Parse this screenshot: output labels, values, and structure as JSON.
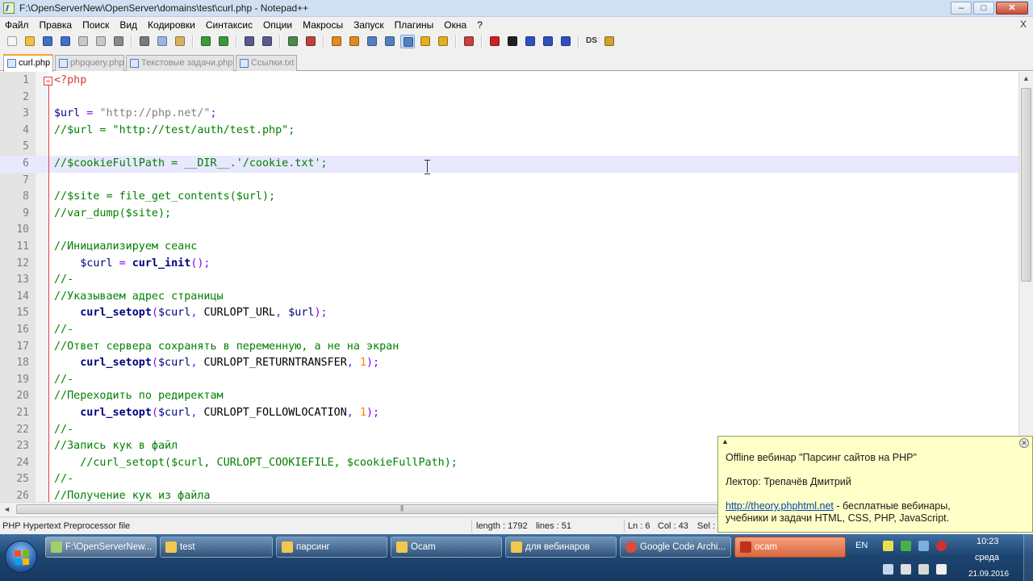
{
  "window": {
    "title": "F:\\OpenServerNew\\OpenServer\\domains\\test\\curl.php - Notepad++",
    "minimize_glyph": "–",
    "maximize_glyph": "□",
    "close_glyph": "✕"
  },
  "menu": {
    "items": [
      "Файл",
      "Правка",
      "Поиск",
      "Вид",
      "Кодировки",
      "Синтаксис",
      "Опции",
      "Макросы",
      "Запуск",
      "Плагины",
      "Окна",
      "?"
    ],
    "close_glyph": "X"
  },
  "toolbar": {
    "buttons": [
      {
        "icon": "new-file-icon",
        "color": "#f7f7f7"
      },
      {
        "icon": "open-file-icon",
        "color": "#f0c040"
      },
      {
        "icon": "save-icon",
        "color": "#3f6fc8"
      },
      {
        "icon": "save-all-icon",
        "color": "#3f6fc8"
      },
      {
        "icon": "close-file-icon",
        "color": "#c8c8c8"
      },
      {
        "icon": "close-all-icon",
        "color": "#c8c8c8"
      },
      {
        "icon": "print-icon",
        "color": "#8a8a8a"
      },
      {
        "icon": "cut-icon",
        "color": "#7a7a7a"
      },
      {
        "icon": "copy-icon",
        "color": "#9ab6e0"
      },
      {
        "icon": "paste-icon",
        "color": "#d8b060"
      },
      {
        "icon": "undo-icon",
        "color": "#3a9a3a"
      },
      {
        "icon": "redo-icon",
        "color": "#3a9a3a"
      },
      {
        "icon": "find-icon",
        "color": "#5a5a8a"
      },
      {
        "icon": "replace-icon",
        "color": "#5a5a8a"
      },
      {
        "icon": "zoom-in-icon",
        "color": "#4a8a4a"
      },
      {
        "icon": "zoom-out-icon",
        "color": "#c04040"
      },
      {
        "icon": "sync-vertical-icon",
        "color": "#e08a20"
      },
      {
        "icon": "sync-horizontal-icon",
        "color": "#e08a20"
      },
      {
        "icon": "word-wrap-icon",
        "color": "#5080c0"
      },
      {
        "icon": "show-all-chars-icon",
        "color": "#5080c0"
      },
      {
        "icon": "indent-guide-icon",
        "color": "#5080c0"
      },
      {
        "icon": "language-icon",
        "color": "#e0b020"
      },
      {
        "icon": "doc-map-icon",
        "color": "#e0b020"
      },
      {
        "icon": "function-list-icon",
        "color": "#c84040"
      },
      {
        "icon": "record-macro-icon",
        "color": "#d02020"
      },
      {
        "icon": "stop-macro-icon",
        "color": "#202020"
      },
      {
        "icon": "play-macro-icon",
        "color": "#3050c0"
      },
      {
        "icon": "run-macro-multiple-icon",
        "color": "#3050c0"
      },
      {
        "icon": "save-macro-icon",
        "color": "#3050c0"
      },
      {
        "icon": "ds-icon",
        "color": "#333333",
        "label": "DS"
      },
      {
        "icon": "plugin-icon",
        "color": "#d0a030"
      }
    ]
  },
  "tabs": [
    {
      "label": "curl.php",
      "active": true
    },
    {
      "label": "phpquery.php",
      "active": false
    },
    {
      "label": "Текстовые задачи.php",
      "active": false
    },
    {
      "label": "Ссылки.txt",
      "active": false
    }
  ],
  "editor": {
    "current_line": 6,
    "lines": [
      {
        "n": "1",
        "tokens": [
          {
            "t": "<?php",
            "c": "kw"
          }
        ]
      },
      {
        "n": "2",
        "tokens": []
      },
      {
        "n": "3",
        "tokens": [
          {
            "t": "$url",
            "c": "var"
          },
          {
            "t": " = ",
            "c": "op"
          },
          {
            "t": "\"http://php.net/\"",
            "c": "str"
          },
          {
            "t": ";",
            "c": "op"
          }
        ]
      },
      {
        "n": "4",
        "tokens": [
          {
            "t": "//$url = \"http://test/auth/test.php\";",
            "c": "cm"
          }
        ]
      },
      {
        "n": "5",
        "tokens": []
      },
      {
        "n": "6",
        "tokens": [
          {
            "t": "//$cookieFullPath = __DIR__.'/cookie.txt';",
            "c": "cm"
          }
        ]
      },
      {
        "n": "7",
        "tokens": []
      },
      {
        "n": "8",
        "tokens": [
          {
            "t": "//$site = file_get_contents($url);",
            "c": "cm"
          }
        ]
      },
      {
        "n": "9",
        "tokens": [
          {
            "t": "//var_dump($site);",
            "c": "cm"
          }
        ]
      },
      {
        "n": "10",
        "tokens": []
      },
      {
        "n": "11",
        "tokens": [
          {
            "t": "//Инициализируем сеанс",
            "c": "cm"
          }
        ]
      },
      {
        "n": "12",
        "tokens": [
          {
            "t": "    ",
            "c": "plain"
          },
          {
            "t": "$curl",
            "c": "var"
          },
          {
            "t": " = ",
            "c": "op"
          },
          {
            "t": "curl_init",
            "c": "fn"
          },
          {
            "t": "();",
            "c": "op"
          }
        ]
      },
      {
        "n": "13",
        "tokens": [
          {
            "t": "//-",
            "c": "cm"
          }
        ]
      },
      {
        "n": "14",
        "tokens": [
          {
            "t": "//Указываем адрес страницы",
            "c": "cm"
          }
        ]
      },
      {
        "n": "15",
        "tokens": [
          {
            "t": "    ",
            "c": "plain"
          },
          {
            "t": "curl_setopt",
            "c": "fn"
          },
          {
            "t": "(",
            "c": "op"
          },
          {
            "t": "$curl",
            "c": "var"
          },
          {
            "t": ", ",
            "c": "op"
          },
          {
            "t": "CURLOPT_URL",
            "c": "const"
          },
          {
            "t": ", ",
            "c": "op"
          },
          {
            "t": "$url",
            "c": "var"
          },
          {
            "t": ");",
            "c": "op"
          }
        ]
      },
      {
        "n": "16",
        "tokens": [
          {
            "t": "//-",
            "c": "cm"
          }
        ]
      },
      {
        "n": "17",
        "tokens": [
          {
            "t": "//Ответ сервера сохранять в переменную, а не на экран",
            "c": "cm"
          }
        ]
      },
      {
        "n": "18",
        "tokens": [
          {
            "t": "    ",
            "c": "plain"
          },
          {
            "t": "curl_setopt",
            "c": "fn"
          },
          {
            "t": "(",
            "c": "op"
          },
          {
            "t": "$curl",
            "c": "var"
          },
          {
            "t": ", ",
            "c": "op"
          },
          {
            "t": "CURLOPT_RETURNTRANSFER",
            "c": "const"
          },
          {
            "t": ", ",
            "c": "op"
          },
          {
            "t": "1",
            "c": "num"
          },
          {
            "t": ");",
            "c": "op"
          }
        ]
      },
      {
        "n": "19",
        "tokens": [
          {
            "t": "//-",
            "c": "cm"
          }
        ]
      },
      {
        "n": "20",
        "tokens": [
          {
            "t": "//Переходить по редиректам",
            "c": "cm"
          }
        ]
      },
      {
        "n": "21",
        "tokens": [
          {
            "t": "    ",
            "c": "plain"
          },
          {
            "t": "curl_setopt",
            "c": "fn"
          },
          {
            "t": "(",
            "c": "op"
          },
          {
            "t": "$curl",
            "c": "var"
          },
          {
            "t": ", ",
            "c": "op"
          },
          {
            "t": "CURLOPT_FOLLOWLOCATION",
            "c": "const"
          },
          {
            "t": ", ",
            "c": "op"
          },
          {
            "t": "1",
            "c": "num"
          },
          {
            "t": ");",
            "c": "op"
          }
        ]
      },
      {
        "n": "22",
        "tokens": [
          {
            "t": "//-",
            "c": "cm"
          }
        ]
      },
      {
        "n": "23",
        "tokens": [
          {
            "t": "//Запись кук в файл",
            "c": "cm"
          }
        ]
      },
      {
        "n": "24",
        "tokens": [
          {
            "t": "    //curl_setopt($curl, CURLOPT_COOKIEFILE, $cookieFullPath);",
            "c": "cm"
          }
        ]
      },
      {
        "n": "25",
        "tokens": [
          {
            "t": "//-",
            "c": "cm"
          }
        ]
      },
      {
        "n": "26",
        "tokens": [
          {
            "t": "//Получение кук из файла",
            "c": "cm"
          }
        ]
      }
    ]
  },
  "scrollbars": {
    "up_glyph": "▲",
    "down_glyph": "▼",
    "left_glyph": "◄",
    "right_glyph": "►",
    "grip_glyph": "|||"
  },
  "statusbar": {
    "file_type": "PHP Hypertext Preprocessor file",
    "length": "length : 1792",
    "lines": "lines : 51",
    "ln": "Ln : 6",
    "col": "Col : 43",
    "sel": "Sel : 0"
  },
  "popup": {
    "up_glyph": "▲",
    "close_glyph": "✕",
    "line1": "Offline вебинар \"Парсинг сайтов на PHP\"",
    "line2": "Лектор: Трепачёв Дмитрий",
    "link": "http://theory.phphtml.net",
    "line3_rest": " - бесплатные вебинары,",
    "line4": "учебники и задачи HTML, CSS, PHP, JavaScript."
  },
  "taskbar": {
    "items": [
      {
        "label": "F:\\OpenServerNew...",
        "icon": "notepadpp-icon",
        "color": "#9fd06a",
        "active": true
      },
      {
        "label": "test",
        "icon": "folder-icon",
        "color": "#f0c850",
        "active": false
      },
      {
        "label": "парсинг",
        "icon": "folder-icon",
        "color": "#f0c850",
        "active": false
      },
      {
        "label": "Ocam",
        "icon": "folder-icon",
        "color": "#f0c850",
        "active": false
      },
      {
        "label": "для вебинаров",
        "icon": "folder-icon",
        "color": "#f0c850",
        "active": false
      },
      {
        "label": "Google Code Archi...",
        "icon": "chrome-icon",
        "color": "#e04a3a",
        "active": false
      },
      {
        "label": "ocam",
        "icon": "ocam-icon",
        "color": "#c03020",
        "active": false,
        "ocam": true
      }
    ],
    "tray": {
      "lang": "EN",
      "time": "10:23",
      "day": "среда",
      "date": "21.09.2016"
    }
  }
}
